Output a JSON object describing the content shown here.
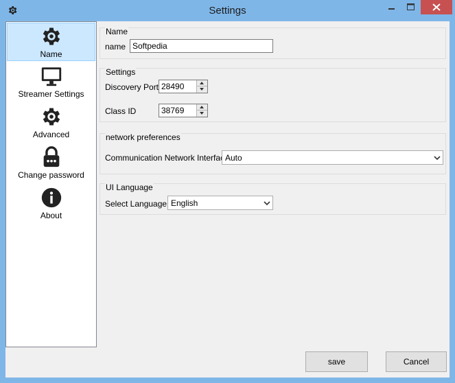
{
  "window": {
    "title": "Settings"
  },
  "sidebar": {
    "items": [
      {
        "label": "Name",
        "icon": "gear-icon",
        "selected": true
      },
      {
        "label": "Streamer Settings",
        "icon": "monitor-icon",
        "selected": false
      },
      {
        "label": "Advanced",
        "icon": "gear-icon",
        "selected": false
      },
      {
        "label": "Change password",
        "icon": "lock-icon",
        "selected": false
      },
      {
        "label": "About",
        "icon": "info-icon",
        "selected": false
      }
    ]
  },
  "name_group": {
    "title": "Name",
    "name_label": "name",
    "name_value": "Softpedia"
  },
  "settings_group": {
    "title": "Settings",
    "discovery_port_label": "Discovery Port",
    "discovery_port_value": "28490",
    "class_id_label": "Class ID",
    "class_id_value": "38769"
  },
  "network_group": {
    "title": "network preferences",
    "interface_label": "Communication Network Interface",
    "interface_value": "Auto"
  },
  "language_group": {
    "title": "UI Language",
    "language_label": "Select Language",
    "language_value": "English"
  },
  "footer": {
    "save_label": "save",
    "cancel_label": "Cancel"
  },
  "colors": {
    "selection": "#cce8ff",
    "frame": "#7fb6e8",
    "close": "#c75050"
  }
}
